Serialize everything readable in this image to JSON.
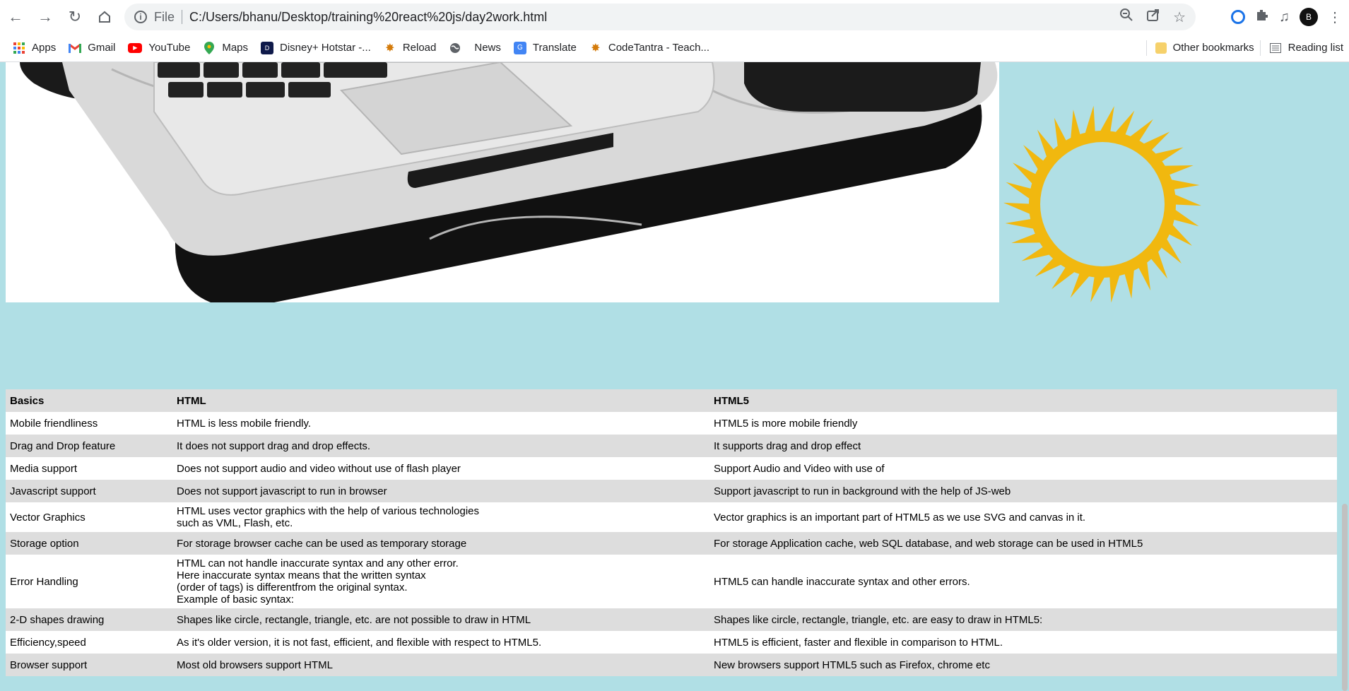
{
  "browser": {
    "url_scheme_label": "File",
    "url": "C:/Users/bhanu/Desktop/training%20react%20js/day2work.html",
    "profile_initial": "B"
  },
  "bookmarks": [
    {
      "label": "Apps",
      "icon": "apps-grid-icon",
      "color": "#ea4335"
    },
    {
      "label": "Gmail",
      "icon": "gmail-icon",
      "color": "#ea4335"
    },
    {
      "label": "YouTube",
      "icon": "youtube-icon",
      "color": "#ff0000"
    },
    {
      "label": "Maps",
      "icon": "maps-pin-icon",
      "color": "#34a853"
    },
    {
      "label": "Disney+ Hotstar -...",
      "icon": "hotstar-icon",
      "color": "#0f1a4a"
    },
    {
      "label": "Reload",
      "icon": "codetantra-icon",
      "color": "#d47b0b"
    },
    {
      "label": "",
      "icon": "globe-icon",
      "color": "#5f6368"
    },
    {
      "label": "News",
      "icon": "",
      "color": ""
    },
    {
      "label": "Translate",
      "icon": "google-translate-icon",
      "color": "#4285f4"
    },
    {
      "label": "CodeTantra - Teach...",
      "icon": "codetantra-icon",
      "color": "#d47b0b"
    }
  ],
  "bookmarks_right": {
    "other": "Other bookmarks",
    "reading": "Reading list"
  },
  "table": {
    "headers": [
      "Basics",
      "HTML",
      "HTML5"
    ],
    "rows": [
      {
        "basic": "Mobile friendliness",
        "html": [
          "HTML is less mobile friendly."
        ],
        "html5": "HTML5 is more mobile friendly"
      },
      {
        "basic": "Drag and Drop feature",
        "html": [
          "It does not support drag and drop effects."
        ],
        "html5": "It supports drag and drop effect"
      },
      {
        "basic": "Media support",
        "html": [
          "Does not support audio and video without use of flash player"
        ],
        "html5": "Support Audio and Video with use of"
      },
      {
        "basic": "Javascript support",
        "html": [
          "Does not support javascript to run in browser"
        ],
        "html5": "Support javascript to run in background with the help of JS-web"
      },
      {
        "basic": "Vector Graphics",
        "html": [
          "HTML uses vector graphics with the help of various technologies",
          "such as VML, Flash, etc."
        ],
        "html5": "Vector graphics is an important part of HTML5 as we use SVG and canvas in it."
      },
      {
        "basic": "Storage option",
        "html": [
          "For storage browser cache can be used as temporary storage"
        ],
        "html5": "For storage Application cache, web SQL database, and web storage can be used in HTML5"
      },
      {
        "basic": "Error Handling",
        "html": [
          "HTML can not handle inaccurate syntax and any other error.",
          "Here inaccurate syntax means that the written syntax",
          "(order of tags) is differentfrom the original syntax.",
          "Example of basic syntax:"
        ],
        "html5": "HTML5 can handle inaccurate syntax and other errors."
      },
      {
        "basic": "2-D shapes drawing",
        "html": [
          "Shapes like circle, rectangle, triangle, etc. are not possible to draw in HTML"
        ],
        "html5": "Shapes like circle, rectangle, triangle, etc. are easy to draw in HTML5:"
      },
      {
        "basic": "Efficiency,speed",
        "html": [
          "As it's older version, it is not fast, efficient, and flexible with respect to HTML5."
        ],
        "html5": "HTML5 is efficient, faster and flexible in comparison to HTML."
      },
      {
        "basic": "Browser support",
        "html": [
          "Most old browsers support HTML"
        ],
        "html5": "New browsers support HTML5 such as Firefox, chrome etc"
      }
    ]
  },
  "colors": {
    "page_bg": "#b0dfe5",
    "sun": "#f1b80f",
    "row_alt": "#dddddd"
  }
}
